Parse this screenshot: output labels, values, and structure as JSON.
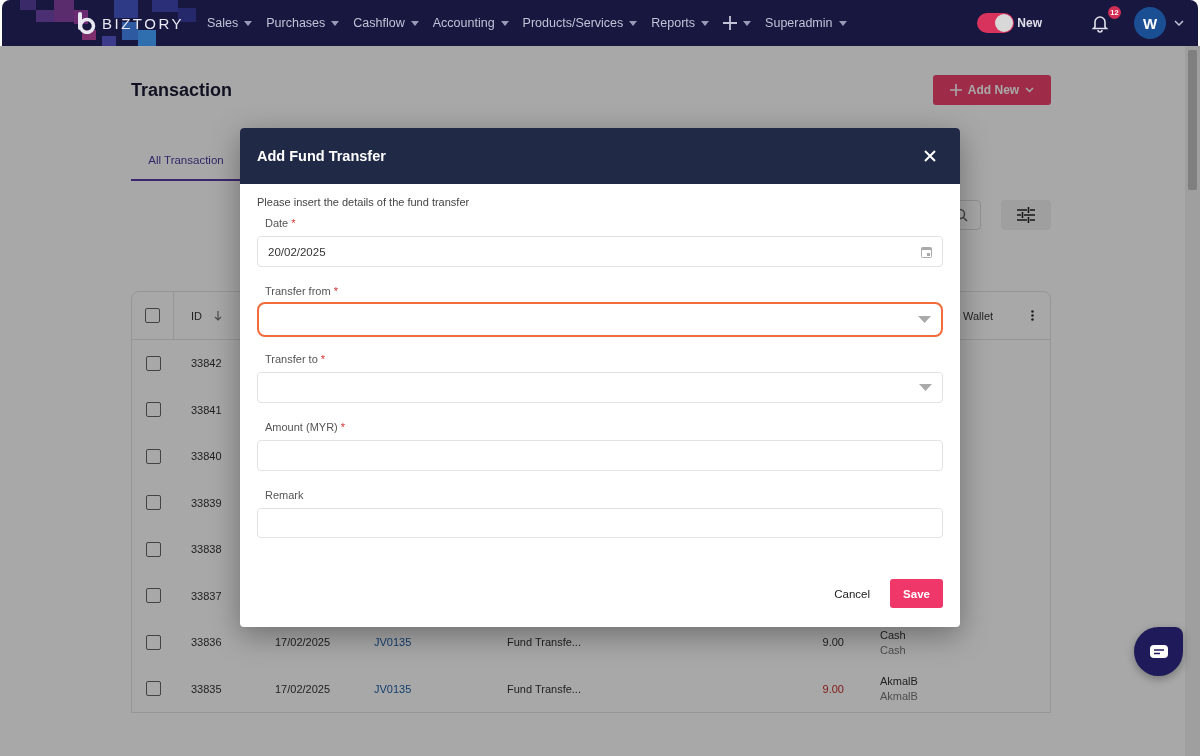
{
  "nav": {
    "brand": "BIZTORY",
    "menu": [
      {
        "kind": "text",
        "label": "Sales"
      },
      {
        "kind": "text",
        "label": "Purchases"
      },
      {
        "kind": "text",
        "label": "Cashflow"
      },
      {
        "kind": "text",
        "label": "Accounting"
      },
      {
        "kind": "text",
        "label": "Products/Services"
      },
      {
        "kind": "text",
        "label": "Reports"
      },
      {
        "kind": "plus"
      },
      {
        "kind": "text",
        "label": "Superadmin"
      }
    ],
    "toggle": {
      "on": true,
      "label": "New"
    },
    "notifications": {
      "count": "12"
    },
    "avatar": {
      "initial": "W"
    }
  },
  "page": {
    "title": "Transaction",
    "add_button": "Add New",
    "tabs": [
      {
        "label": "All Transaction",
        "selected": true
      }
    ],
    "table": {
      "select_all": {
        "checked": false
      },
      "columns": [
        {
          "label": "ID",
          "sorted": true
        },
        {
          "label": "Wallet"
        }
      ],
      "rows": [
        {
          "checked": false,
          "id": "33842"
        },
        {
          "checked": false,
          "id": "33841"
        },
        {
          "checked": false,
          "id": "33840"
        },
        {
          "checked": false,
          "id": "33839"
        },
        {
          "checked": false,
          "id": "33838"
        },
        {
          "checked": false,
          "id": "33837"
        },
        {
          "checked": false,
          "id": "33836",
          "date": "17/02/2025",
          "ref": "JV0135",
          "description": "Fund Transfe...",
          "amount": "9.00",
          "negative": false,
          "wallet": "Cash",
          "wallet_sub": "Cash"
        },
        {
          "checked": false,
          "id": "33835",
          "date": "17/02/2025",
          "ref": "JV0135",
          "description": "Fund Transfe...",
          "amount": "9.00",
          "negative": true,
          "wallet": "AkmalB",
          "wallet_sub": "AkmalB"
        }
      ]
    }
  },
  "modal": {
    "title": "Add Fund Transfer",
    "intro": "Please insert the details of the fund transfer",
    "fields": [
      {
        "kind": "date",
        "label": "Date",
        "required_mark": "*",
        "value": "20/02/2025",
        "focused": false
      },
      {
        "kind": "select",
        "label": "Transfer from",
        "required_mark": "*",
        "focused": true
      },
      {
        "kind": "select",
        "label": "Transfer to",
        "required_mark": "*",
        "focused": false
      },
      {
        "kind": "text",
        "label": "Amount (MYR)",
        "required_mark": "*",
        "focused": false
      },
      {
        "kind": "text",
        "label": "Remark",
        "focused": false
      }
    ],
    "cancel": "Cancel",
    "save": "Save"
  }
}
